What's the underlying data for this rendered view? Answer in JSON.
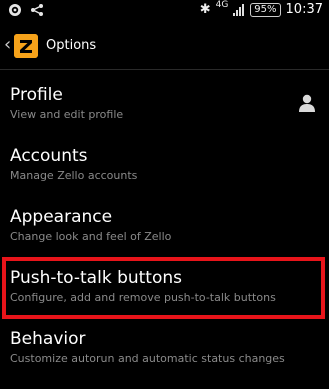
{
  "status_bar": {
    "network_label": "4G",
    "battery_percent": "95%",
    "time": "10:37",
    "icons": [
      "whatsapp-icon",
      "share-icon",
      "bluetooth-icon",
      "signal-icon",
      "battery-icon"
    ]
  },
  "action_bar": {
    "title": "Options",
    "logo_icon": "zello-logo-icon"
  },
  "options": [
    {
      "title": "Profile",
      "subtitle": "View and edit profile",
      "trailing_icon": "person-icon"
    },
    {
      "title": "Accounts",
      "subtitle": "Manage Zello accounts"
    },
    {
      "title": "Appearance",
      "subtitle": "Change look and feel of Zello"
    },
    {
      "title": "Push-to-talk buttons",
      "subtitle": "Configure, add and remove push-to-talk buttons",
      "highlighted": true
    },
    {
      "title": "Behavior",
      "subtitle": "Customize autorun and automatic status changes"
    }
  ],
  "colors": {
    "background": "#000000",
    "subtitle": "#8a8a8a",
    "highlight": "#e8141a",
    "logo": "#f6a21a"
  }
}
